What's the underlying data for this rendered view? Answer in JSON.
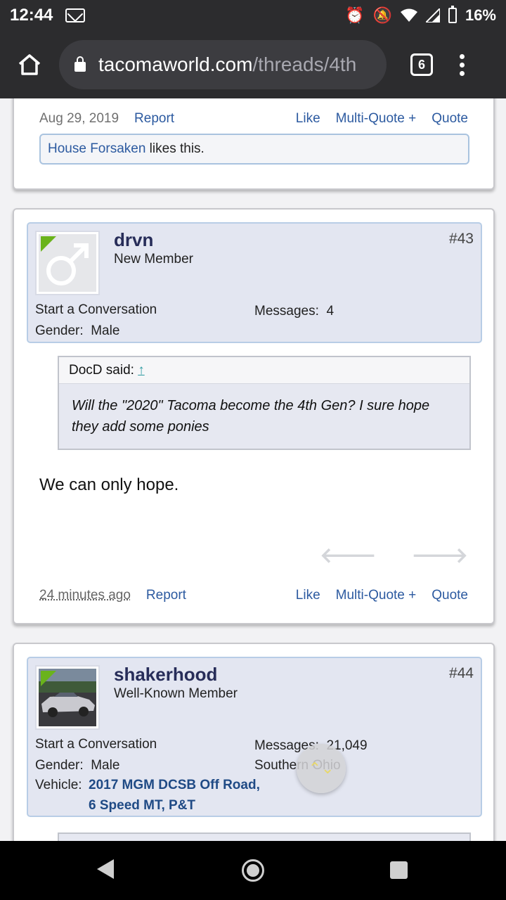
{
  "status_bar": {
    "time": "12:44",
    "battery": "16%",
    "icons": [
      "gmail-icon",
      "alarm-icon",
      "silent-icon",
      "wifi-icon",
      "signal-icon",
      "battery-icon"
    ]
  },
  "browser": {
    "url_host": "tacomaworld.com",
    "url_path": "/threads/4th",
    "tab_count": "6"
  },
  "prev_post": {
    "date": "Aug 29, 2019",
    "report": "Report",
    "like": "Like",
    "multiquote": "Multi-Quote +",
    "quote": "Quote",
    "likes_user": "House Forsaken",
    "likes_suffix": " likes this."
  },
  "post43": {
    "username": "drvn",
    "user_title": "New Member",
    "post_number": "#43",
    "start_conversation": "Start a Conversation",
    "messages_label": "Messages:",
    "messages_value": "4",
    "gender_label": "Gender:",
    "gender_value": "Male",
    "quote_author": "DocD said:",
    "quote_arrow": "↑",
    "quote_text": "Will the \"2020\" Tacoma become the 4th Gen? I sure hope they add some ponies",
    "body": "We can only hope.",
    "time_ago": "24 minutes ago",
    "report": "Report",
    "like": "Like",
    "multiquote": "Multi-Quote +",
    "quote": "Quote"
  },
  "post44": {
    "username": "shakerhood",
    "user_title": "Well-Known Member",
    "post_number": "#44",
    "start_conversation": "Start a Conversation",
    "messages_label": "Messages:",
    "messages_value": "21,049",
    "gender_label": "Gender:",
    "gender_value": "Male",
    "location": "Southern Ohio",
    "vehicle_label": "Vehicle:",
    "vehicle_line1": "2017 MGM DCSB Off Road,",
    "vehicle_line2": "6 Speed MT, P&T"
  },
  "colors": {
    "link": "#2c5aa0",
    "username": "#272d59",
    "user_block_bg": "#e3e6f1",
    "online": "#6ab31b"
  }
}
